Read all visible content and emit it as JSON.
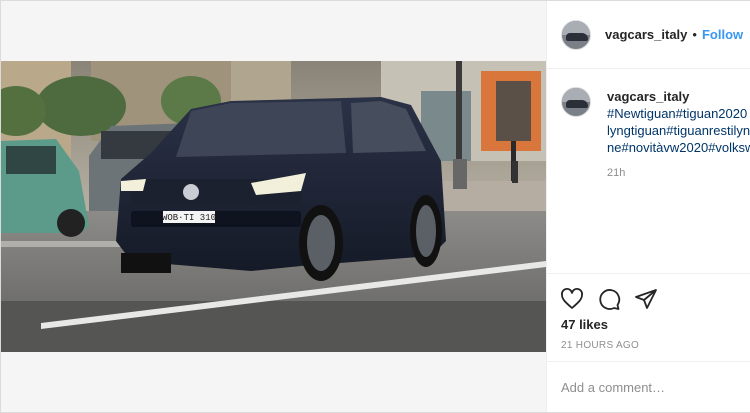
{
  "post": {
    "username": "vagcars_italy",
    "separator": "•",
    "follow_label": "Follow",
    "caption_lines": [
      "#Newtiguan#tiguan2020",
      "lyngtiguan#tiguanrestilyn",
      "ne#novitàvw2020#volksw"
    ],
    "time_short": "21h",
    "likes": "47 likes",
    "time_ago": "21 HOURS AGO",
    "comment_placeholder": "Add a comment…",
    "plate": "WOB·TI 310"
  },
  "icons": {
    "like": "heart-icon",
    "comment": "comment-icon",
    "share": "share-icon"
  }
}
